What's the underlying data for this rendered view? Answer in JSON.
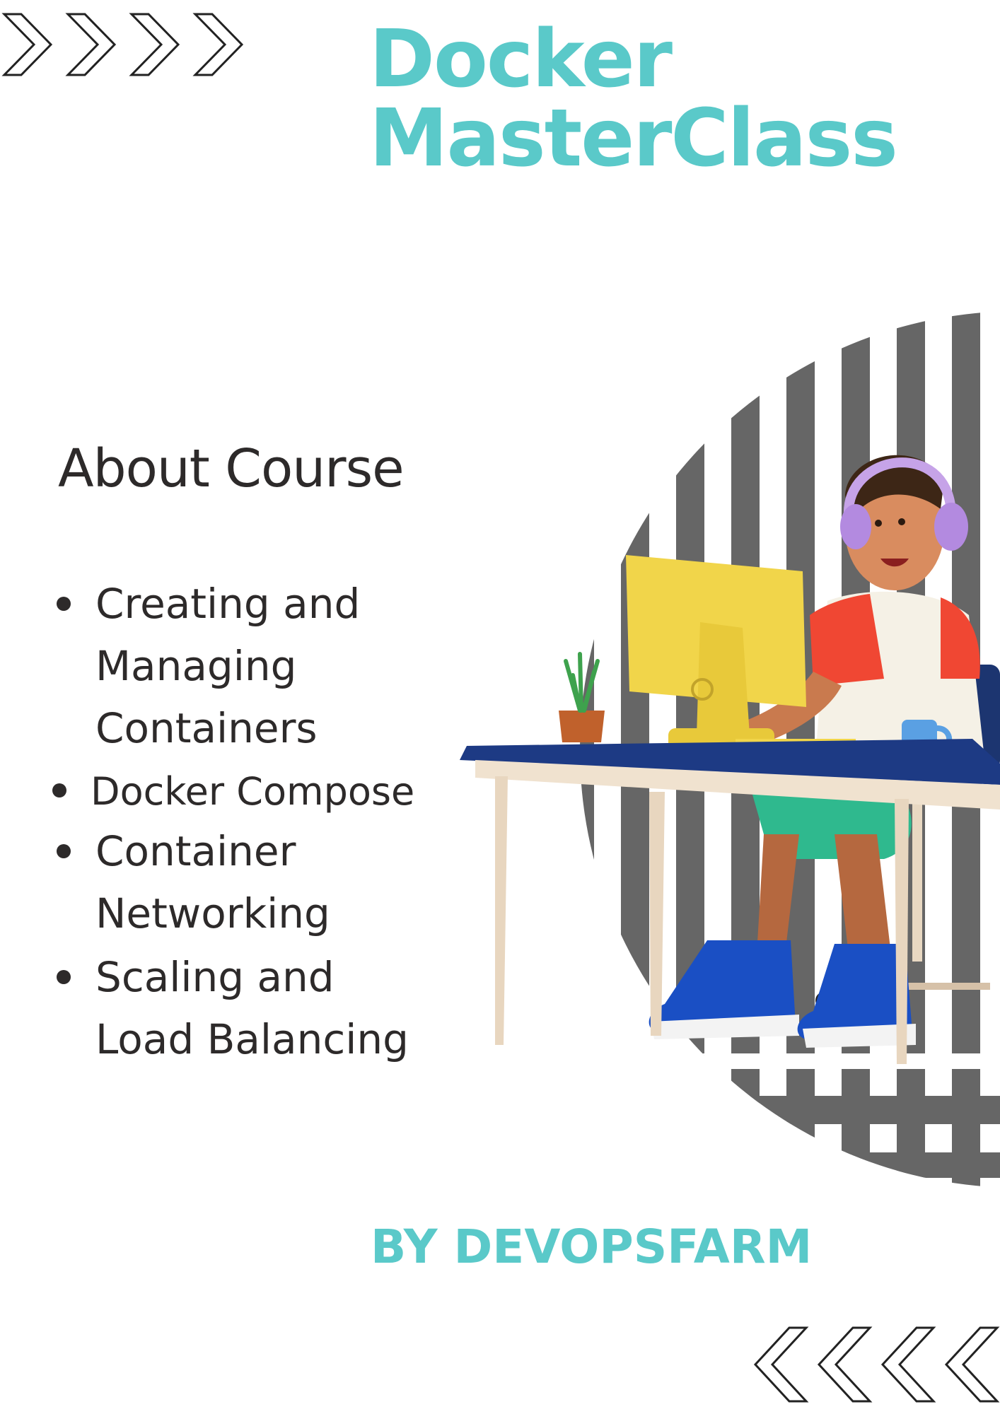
{
  "title": {
    "line1": "Docker",
    "line2": "MasterClass"
  },
  "about": {
    "heading": "About Course",
    "items": [
      {
        "lines": [
          "Creating and",
          "Managing",
          "Containers"
        ]
      },
      {
        "lines": [
          "Docker Compose"
        ]
      },
      {
        "lines": [
          "Container",
          "Networking"
        ]
      },
      {
        "lines": [
          "Scaling and",
          "Load Balancing"
        ]
      }
    ]
  },
  "byline": "BY DEVOPSFARM",
  "colors": {
    "accent": "#5ac9c9",
    "text": "#2d2a2a",
    "stripes": "#666666",
    "background": "#ffffff"
  },
  "icons": {
    "top_left": "chevron-right-icon",
    "bottom_right": "chevron-left-icon",
    "illustration": "developer-at-desk-illustration"
  }
}
